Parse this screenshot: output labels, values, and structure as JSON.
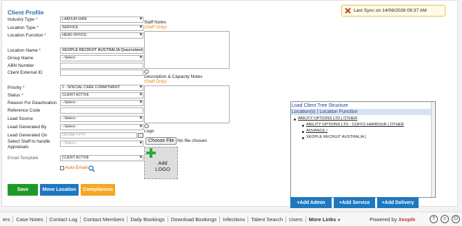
{
  "form": {
    "title": "Client Profile",
    "sync": "Last Sync on 14/08/2026 09:37 AM",
    "fields": {
      "industry_type": {
        "label": "Industry Type",
        "value": "LABOUR-HIRE"
      },
      "location_type": {
        "label": "Location Type",
        "value": "SERVICE"
      },
      "location_function": {
        "label": "Location Function",
        "value": "HEAD OFFICE"
      },
      "location_name": {
        "label": "Location Name",
        "value": "XEOPLE RECRUIT AUSTRALIA Queensland"
      },
      "group_name": {
        "label": "Group Name",
        "value": "--Select--"
      },
      "abn_number": {
        "label": "ABN Number",
        "value": ""
      },
      "client_external_id": {
        "label": "Client External ID",
        "value": ""
      },
      "priority": {
        "label": "Priority",
        "value": "1 - SPECIAL CARE COMMITMENT"
      },
      "status": {
        "label": "Status",
        "value": "CLIENT ACTIVE"
      },
      "reason_deactivation": {
        "label": "Reason For Deactivation",
        "value": "--Select--"
      },
      "reference_code": {
        "label": "Reference Code",
        "value": ""
      },
      "lead_source": {
        "label": "Lead Source",
        "value": "--Select--"
      },
      "lead_generated_by": {
        "label": "Lead Generated By",
        "value": "--Select--"
      },
      "lead_generated_on": {
        "label": "Lead Generated On",
        "placeholder": "DD-MM-YYYY"
      },
      "select_staff": {
        "label": "Select Staff to handle Appraisals",
        "value": "--Select--"
      },
      "email_template": {
        "label": "Email Template",
        "value": "CLIENT ACTIVE"
      },
      "auto_email": {
        "label": "Auto Email"
      }
    },
    "staff_notes": {
      "label": "Staff Notes",
      "sub": "(Staff Only)"
    },
    "description_notes": {
      "label": "Description & Capacity Notes",
      "sub": "(Staff Only)"
    },
    "logo": {
      "label": "Logo",
      "choose_file": "Choose File",
      "no_file": "No file chosen",
      "add_logo": "Add LOGO"
    },
    "buttons": {
      "save": "Save",
      "move_location": "Move Location",
      "compliances": "Compliances"
    }
  },
  "tree": {
    "title": "Load Client Tree Structure",
    "header": "Location(s) | Location Function",
    "nodes": [
      "ABILITY OPTIONS LTD | OTHER",
      "ABILITY OPTIONS LTD - COFFS HARBOUR | OTHER",
      "ADVANCE |",
      "XEOPLE RECRUIT AUSTRALIA |"
    ],
    "buttons": {
      "add_admin": "+Add Admin",
      "add_service": "+Add Service",
      "add_delivery": "+Add Delivery"
    }
  },
  "footer": {
    "tabs": [
      "ers",
      "Case Notes",
      "Contact Log",
      "Contact Members",
      "Daily Bookings",
      "Download Bookings",
      "Infections",
      "Talent Search",
      "Users",
      "More Links »"
    ],
    "powered_by": "Powered by",
    "brand": "Xeople"
  },
  "colors": {
    "accent": "#1e78c0",
    "save": "#1f9a2a",
    "move": "#1e78c0",
    "compliances": "#f5a623"
  }
}
